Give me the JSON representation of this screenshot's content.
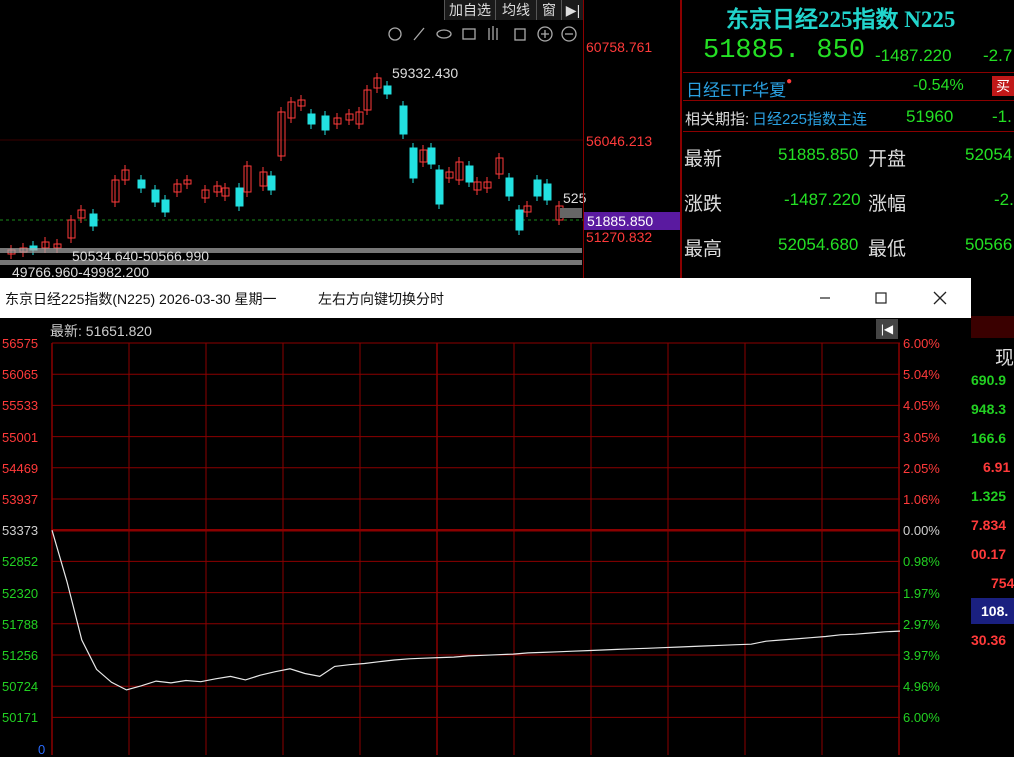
{
  "toolbar": {
    "add_watch": "加自选",
    "ma_line": "均线",
    "window": "窗",
    "exit_icon": "exit-fullscreen-icon"
  },
  "kline": {
    "price_high_label": "60758.761",
    "price_mid_label": "56046.213",
    "price_low_label": "51270.832",
    "current_price_tag": "51885.850",
    "peak_annotation": "59332.430",
    "partial_label": "525",
    "range_label_1": "50534.640-50566.990",
    "range_label_2": "49766.960-49982.200"
  },
  "quote": {
    "title": "东京日经225指数 N225",
    "last_price": "51885. 850",
    "change": "-1487.220",
    "change_pct_partial": "-2.7",
    "etf_name": "日经ETF华夏",
    "etf_change": "-0.54%",
    "etf_buy": "买",
    "related_label": "相关期指:",
    "related_name": "日经225指数主连",
    "related_value": "51960",
    "related_partial": "-1.",
    "rows": [
      {
        "k1": "最新",
        "v1": "51885.850",
        "k2": "开盘",
        "v2": "52054"
      },
      {
        "k1": "涨跌",
        "v1": "-1487.220",
        "k2": "涨幅",
        "v2": "-2."
      },
      {
        "k1": "最高",
        "v1": "52054.680",
        "k2": "最低",
        "v2": "50566"
      }
    ]
  },
  "popup": {
    "title": "东京日经225指数(N225) 2026-03-30 星期一",
    "hint": "左右方向键切换分时",
    "latest_label": "最新: 51651.820",
    "price_labels": [
      "56575",
      "56065",
      "55533",
      "55001",
      "54469",
      "53937",
      "53373",
      "52852",
      "52320",
      "51788",
      "51256",
      "50724",
      "50171",
      "0"
    ],
    "pct_labels": [
      "6.00%",
      "5.04%",
      "4.05%",
      "3.05%",
      "2.05%",
      "1.06%",
      "0.00%",
      "0.98%",
      "1.97%",
      "2.97%",
      "3.97%",
      "4.96%",
      "6.00%"
    ],
    "intraday_values": [
      53373,
      52500,
      51500,
      51000,
      50780,
      50650,
      50720,
      50800,
      50770,
      50810,
      50790,
      50840,
      50880,
      50820,
      50900,
      50960,
      51010,
      50930,
      50880,
      51050,
      51080,
      51100,
      51130,
      51160,
      51180,
      51190,
      51200,
      51210,
      51230,
      51240,
      51250,
      51260,
      51280,
      51290,
      51300,
      51310,
      51320,
      51330,
      51340,
      51350,
      51360,
      51370,
      51380,
      51390,
      51400,
      51410,
      51420,
      51430,
      51480,
      51500,
      51520,
      51540,
      51560,
      51590,
      51600,
      51620,
      51640,
      51651.82
    ]
  },
  "right_column": {
    "header": "现",
    "values": [
      "690.9",
      "948.3",
      "166.6",
      "6.91",
      "1.325",
      "7.834",
      "00.17",
      "754",
      "108.",
      "30.36"
    ]
  },
  "colors": {
    "accent_cyan": "#22d5cc",
    "down_green": "#24e024",
    "up_red": "#ff3a3a",
    "grid_red": "#8b0000",
    "tag_purple": "#5a1aa0"
  }
}
